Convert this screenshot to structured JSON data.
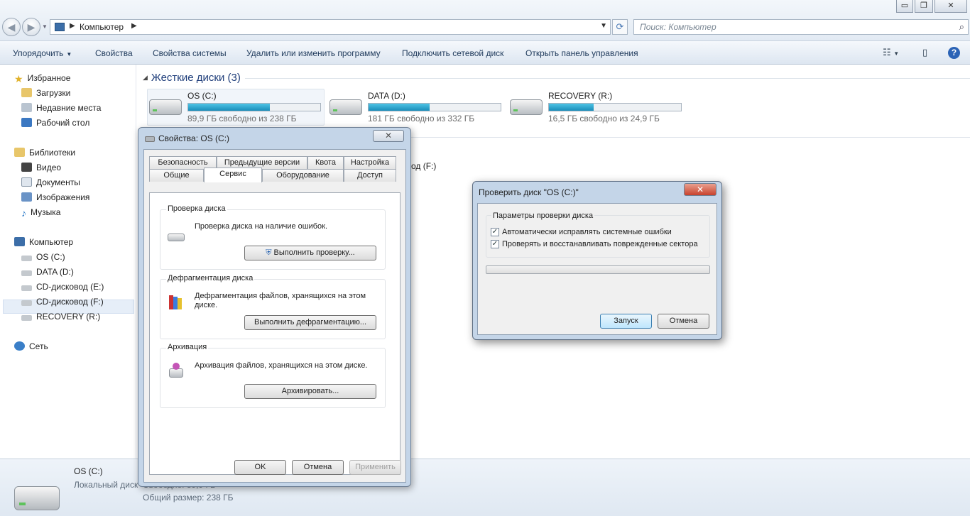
{
  "window": {
    "minimize": "▭",
    "maximize": "❐",
    "close": "✕"
  },
  "address": {
    "path": "Компьютер",
    "search_placeholder": "Поиск: Компьютер"
  },
  "toolbar": {
    "organize": "Упорядочить",
    "properties": "Свойства",
    "system_properties": "Свойства системы",
    "uninstall": "Удалить или изменить программу",
    "map_drive": "Подключить сетевой диск",
    "control_panel": "Открыть панель управления"
  },
  "sidebar": {
    "favorites": "Избранное",
    "downloads": "Загрузки",
    "recent": "Недавние места",
    "desktop": "Рабочий стол",
    "libraries": "Библиотеки",
    "video": "Видео",
    "documents": "Документы",
    "pictures": "Изображения",
    "music": "Музыка",
    "computer": "Компьютер",
    "os_c": "OS (C:)",
    "data_d": "DATA (D:)",
    "cd_e": "CD-дисковод (E:)",
    "cd_f": "CD-дисковод (F:)",
    "recovery_r": "RECOVERY (R:)",
    "network": "Сеть"
  },
  "content": {
    "group_title": "Жесткие диски (3)",
    "partial_f": "од (F:)",
    "drives": [
      {
        "name": "OS (C:)",
        "free": "89,9 ГБ свободно из 238 ГБ",
        "used_fraction": 0.62
      },
      {
        "name": "DATA (D:)",
        "free": "181 ГБ свободно из 332 ГБ",
        "used_fraction": 0.46
      },
      {
        "name": "RECOVERY (R:)",
        "free": "16,5 ГБ свободно из 24,9 ГБ",
        "used_fraction": 0.34
      }
    ]
  },
  "details": {
    "name": "OS (C:)",
    "type": "Локальный диск",
    "partial_free": "Свободно: 89,9 ГБ",
    "total": "Общий размер: 238 ГБ"
  },
  "props": {
    "title": "Свойства: OS (C:)",
    "tabs_row1": [
      "Безопасность",
      "Предыдущие версии",
      "Квота",
      "Настройка"
    ],
    "tabs_row2": [
      "Общие",
      "Сервис",
      "Оборудование",
      "Доступ"
    ],
    "check_title": "Проверка диска",
    "check_desc": "Проверка диска на наличие ошибок.",
    "check_btn": "Выполнить проверку...",
    "defrag_title": "Дефрагментация диска",
    "defrag_desc": "Дефрагментация файлов, хранящихся на этом диске.",
    "defrag_btn": "Выполнить дефрагментацию...",
    "backup_title": "Архивация",
    "backup_desc": "Архивация файлов, хранящихся на этом диске.",
    "backup_btn": "Архивировать...",
    "ok": "OK",
    "cancel": "Отмена",
    "apply": "Применить"
  },
  "chkdsk": {
    "title": "Проверить диск \"OS (C:)\"",
    "group": "Параметры проверки диска",
    "opt1": "Автоматически исправлять системные ошибки",
    "opt2": "Проверять и восстанавливать поврежденные сектора",
    "start": "Запуск",
    "cancel": "Отмена",
    "progress": 0
  },
  "colors": {
    "accent": "#1e3d7a",
    "bar_fill": "#1a8db9"
  }
}
